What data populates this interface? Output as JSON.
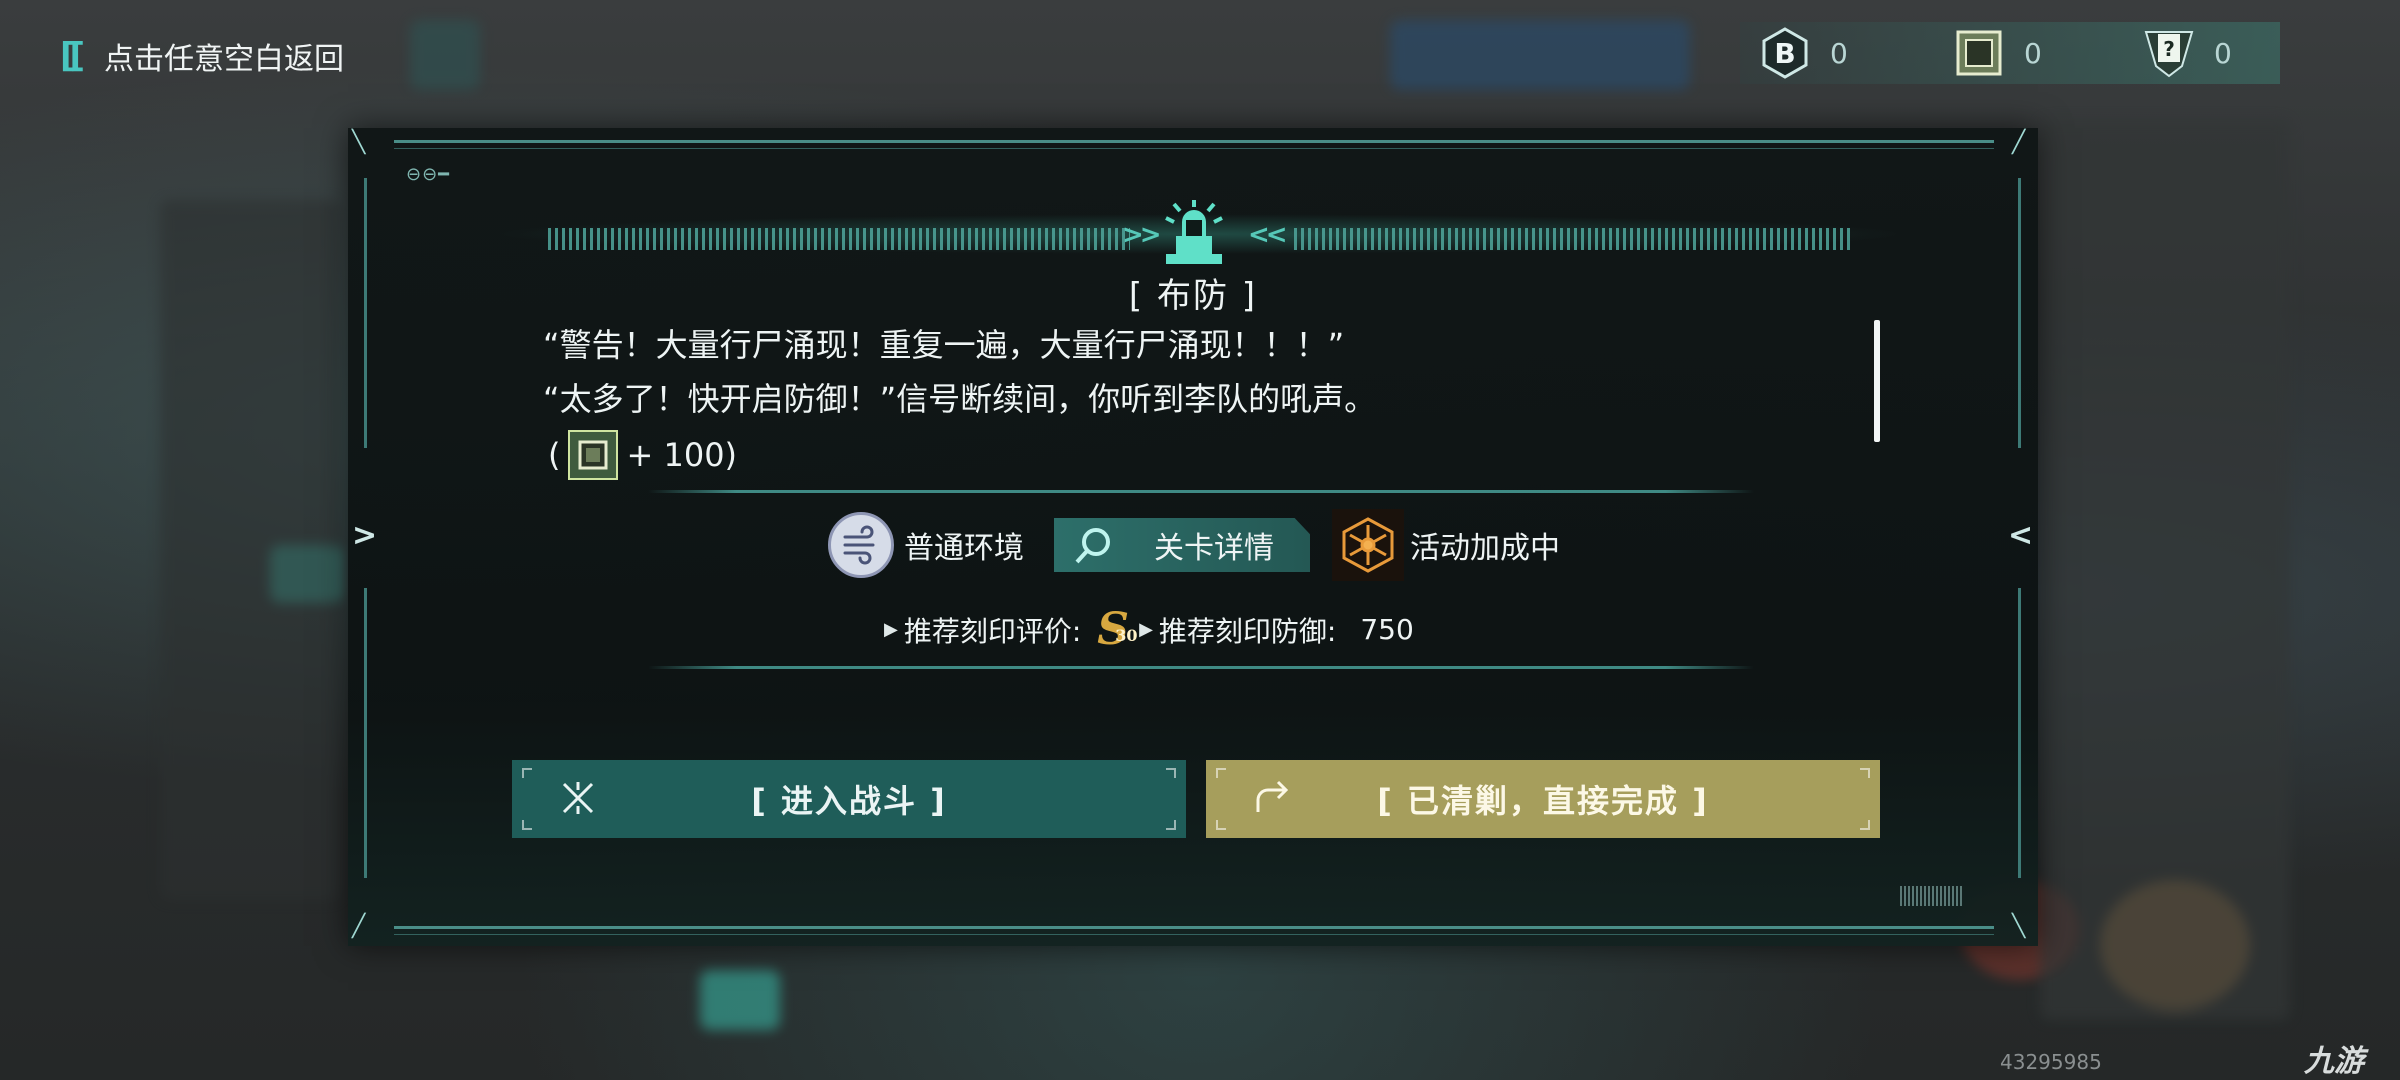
{
  "back": {
    "label": "点击任意空白返回"
  },
  "currencies": [
    {
      "icon": "coin-b-icon",
      "value": "0"
    },
    {
      "icon": "chip-icon",
      "value": "0"
    },
    {
      "icon": "mystery-card-icon",
      "value": "0"
    }
  ],
  "panel": {
    "title": "[ 布防 ]",
    "dialog": [
      "“警告！大量行尸涌现！重复一遍，大量行尸涌现！！！”",
      "“太多了！快开启防御！”信号断续间，你听到李队的吼声。"
    ],
    "reward": {
      "open": "(",
      "amount": "+ 100)",
      "icon": "chip-icon"
    },
    "environment": {
      "label": "普通环境",
      "icon": "wind-icon"
    },
    "details_button": {
      "label": "关卡详情",
      "icon": "magnifier-icon"
    },
    "bonus": {
      "label": "活动加成中",
      "icon": "snowflake-badge-icon"
    },
    "recommended_rating": {
      "label": "推荐刻印评价:",
      "rank": "S",
      "rank_sub": "30"
    },
    "recommended_defense": {
      "label": "推荐刻印防御:",
      "value": "750"
    },
    "buttons": {
      "fight": "[ 进入战斗 ]",
      "skip": "[ 已清剿，直接完成 ]"
    }
  },
  "watermark": {
    "id": "43295985",
    "logo": "九游"
  },
  "colors": {
    "accent": "#49c6c0",
    "fight_button": "#1f5d59",
    "skip_button": "#a69e5c",
    "panel_bg": "#101616"
  }
}
